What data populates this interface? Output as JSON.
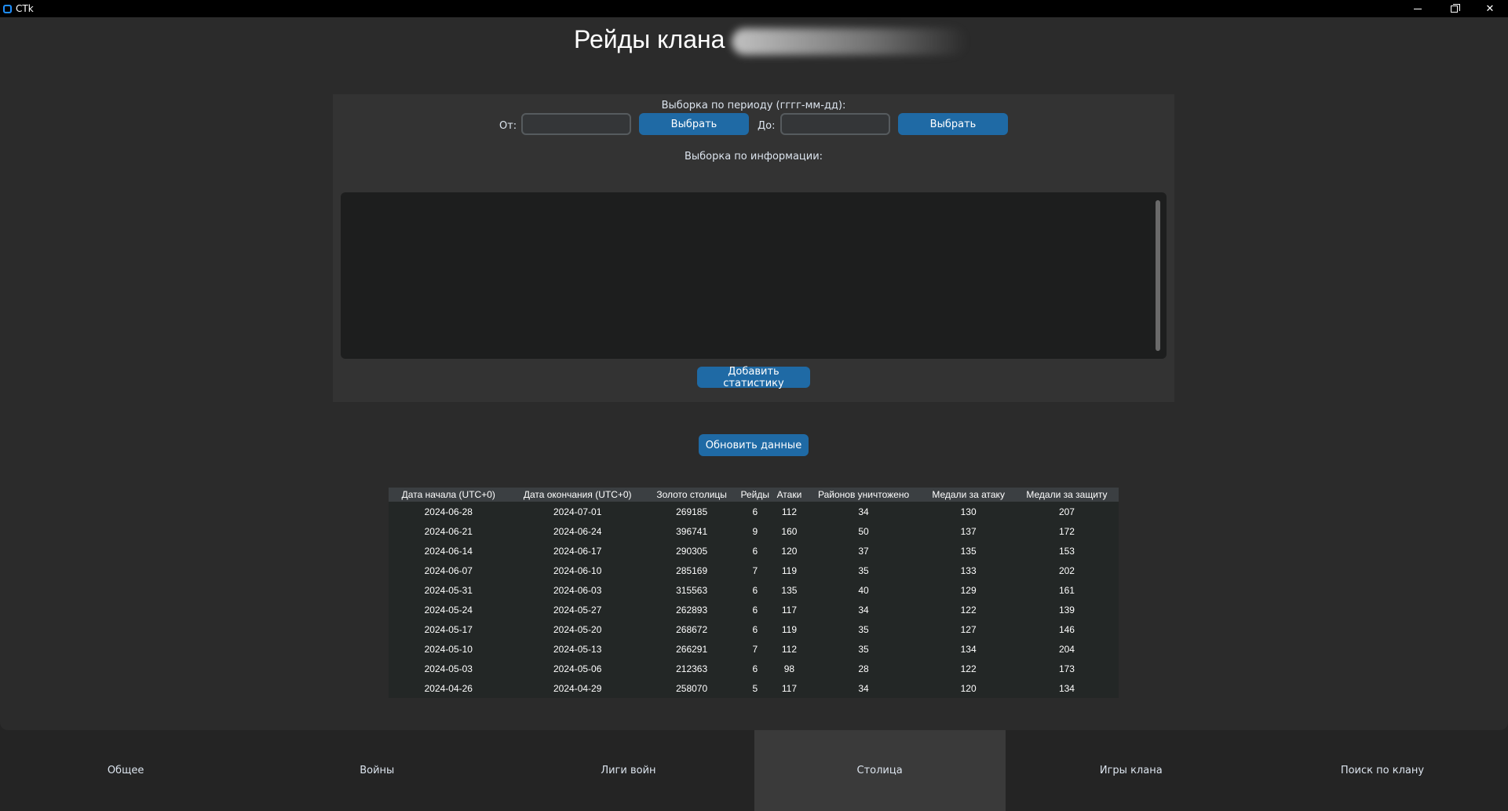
{
  "window": {
    "title": "CTk",
    "minimize_label": "",
    "maximize_label": "",
    "close_label": "✕"
  },
  "page": {
    "title": "Рейды клана"
  },
  "filter": {
    "period_label": "Выборка по периоду (гггг-мм-дд):",
    "from_label": "От:",
    "from_value": "",
    "from_select_label": "Выбрать",
    "to_label": "До:",
    "to_value": "",
    "to_select_label": "Выбрать",
    "info_label": "Выборка по информации:",
    "info_value": "",
    "add_stat_label": "Добавить статистику"
  },
  "refresh_label": "Обновить данные",
  "table": {
    "headers": [
      "Дата начала (UTC+0)",
      "Дата окончания (UTC+0)",
      "Золото столицы",
      "Рейды",
      "Атаки",
      "Районов уничтожено",
      "Медали за атаку",
      "Медали за защиту"
    ],
    "rows": [
      [
        "2024-06-28",
        "2024-07-01",
        "269185",
        "6",
        "112",
        "34",
        "130",
        "207"
      ],
      [
        "2024-06-21",
        "2024-06-24",
        "396741",
        "9",
        "160",
        "50",
        "137",
        "172"
      ],
      [
        "2024-06-14",
        "2024-06-17",
        "290305",
        "6",
        "120",
        "37",
        "135",
        "153"
      ],
      [
        "2024-06-07",
        "2024-06-10",
        "285169",
        "7",
        "119",
        "35",
        "133",
        "202"
      ],
      [
        "2024-05-31",
        "2024-06-03",
        "315563",
        "6",
        "135",
        "40",
        "129",
        "161"
      ],
      [
        "2024-05-24",
        "2024-05-27",
        "262893",
        "6",
        "117",
        "34",
        "122",
        "139"
      ],
      [
        "2024-05-17",
        "2024-05-20",
        "268672",
        "6",
        "119",
        "35",
        "127",
        "146"
      ],
      [
        "2024-05-10",
        "2024-05-13",
        "266291",
        "7",
        "112",
        "35",
        "134",
        "204"
      ],
      [
        "2024-05-03",
        "2024-05-06",
        "212363",
        "6",
        "98",
        "28",
        "122",
        "173"
      ],
      [
        "2024-04-26",
        "2024-04-29",
        "258070",
        "5",
        "117",
        "34",
        "120",
        "134"
      ]
    ]
  },
  "tabs": [
    {
      "label": "Общее",
      "active": false
    },
    {
      "label": "Войны",
      "active": false
    },
    {
      "label": "Лиги войн",
      "active": false
    },
    {
      "label": "Столица",
      "active": true
    },
    {
      "label": "Игры клана",
      "active": false
    },
    {
      "label": "Поиск по клану",
      "active": false
    }
  ],
  "colors": {
    "accent": "#1f6aa5",
    "background": "#2b2b2b",
    "panel": "#333333",
    "active_tab": "#3a3a3a"
  }
}
